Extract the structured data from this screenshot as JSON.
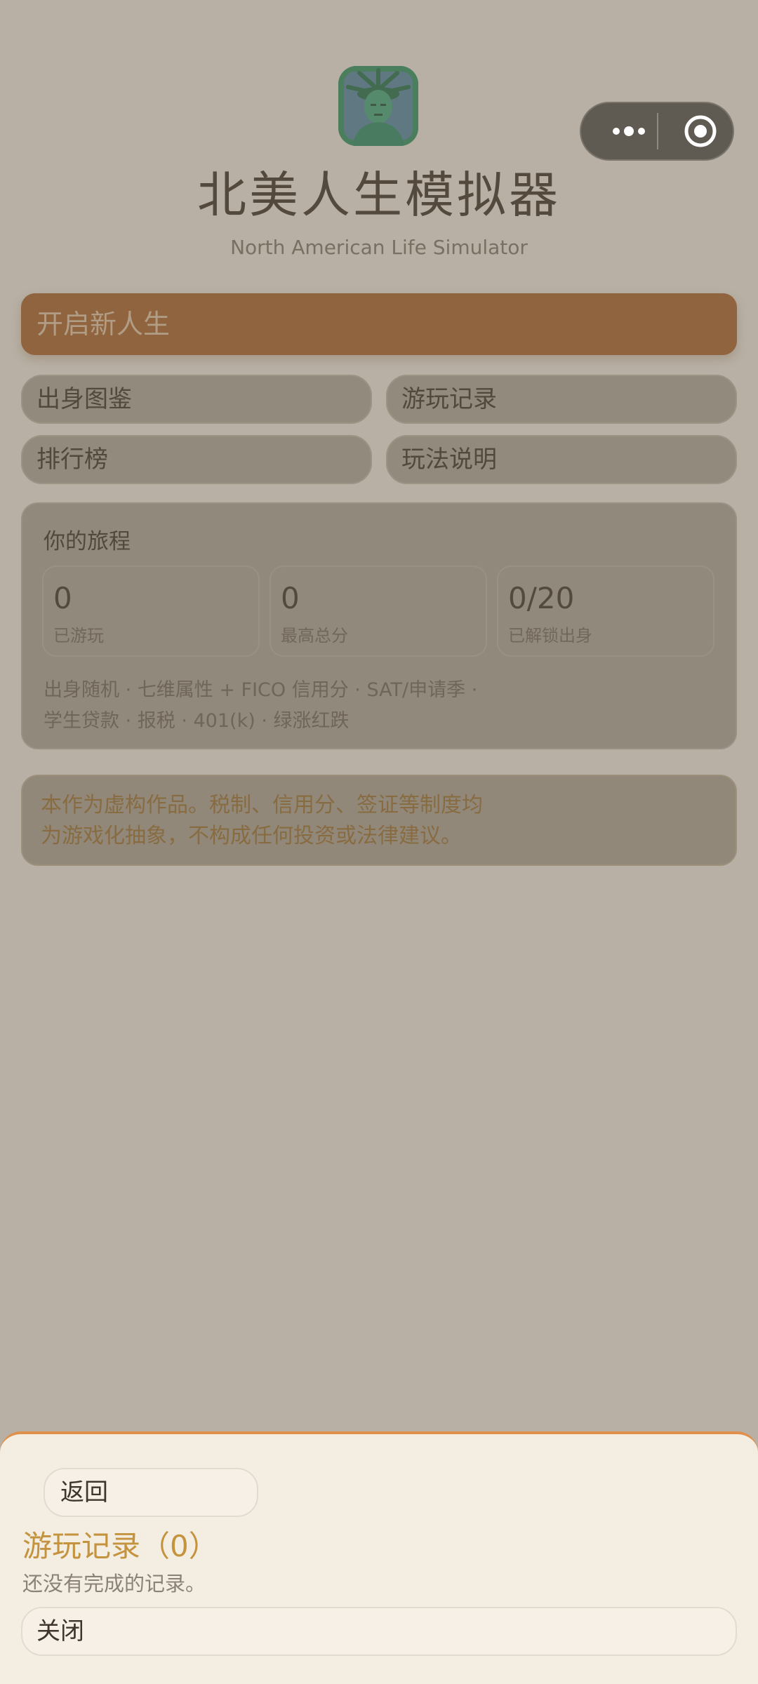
{
  "app": {
    "title": "北美人生模拟器",
    "subtitle": "North American Life Simulator",
    "logo_icon": "statue-of-liberty-icon"
  },
  "capsule": {
    "more_icon": "more-dots-icon",
    "close_icon": "target-circle-icon"
  },
  "menu": {
    "primary_label": "开启新人生",
    "buttons": [
      "出身图鉴",
      "游玩记录",
      "排行榜",
      "玩法说明"
    ]
  },
  "journey": {
    "title": "你的旅程",
    "stats": [
      {
        "value": "0",
        "label": "已游玩"
      },
      {
        "value": "0",
        "label": "最高总分"
      },
      {
        "value": "0/20",
        "label": "已解锁出身"
      }
    ],
    "tags_line1": "出身随机 · 七维属性 + FICO 信用分 · SAT/申请季 ·",
    "tags_line2": "学生贷款 · 报税 · 401(k) · 绿涨红跌"
  },
  "disclaimer": {
    "line1": "本作为虚构作品。税制、信用分、签证等制度均",
    "line2": "为游戏化抽象，不构成任何投资或法律建议。"
  },
  "sheet": {
    "back_label": "返回",
    "title": "游玩记录（0）",
    "empty_text": "还没有完成的记录。",
    "close_label": "关闭"
  },
  "colors": {
    "accent": "#b06f3a",
    "sheet_title": "#c4933d",
    "disclaimer_text": "#a37b3e",
    "sheet_border": "#e0904a"
  }
}
